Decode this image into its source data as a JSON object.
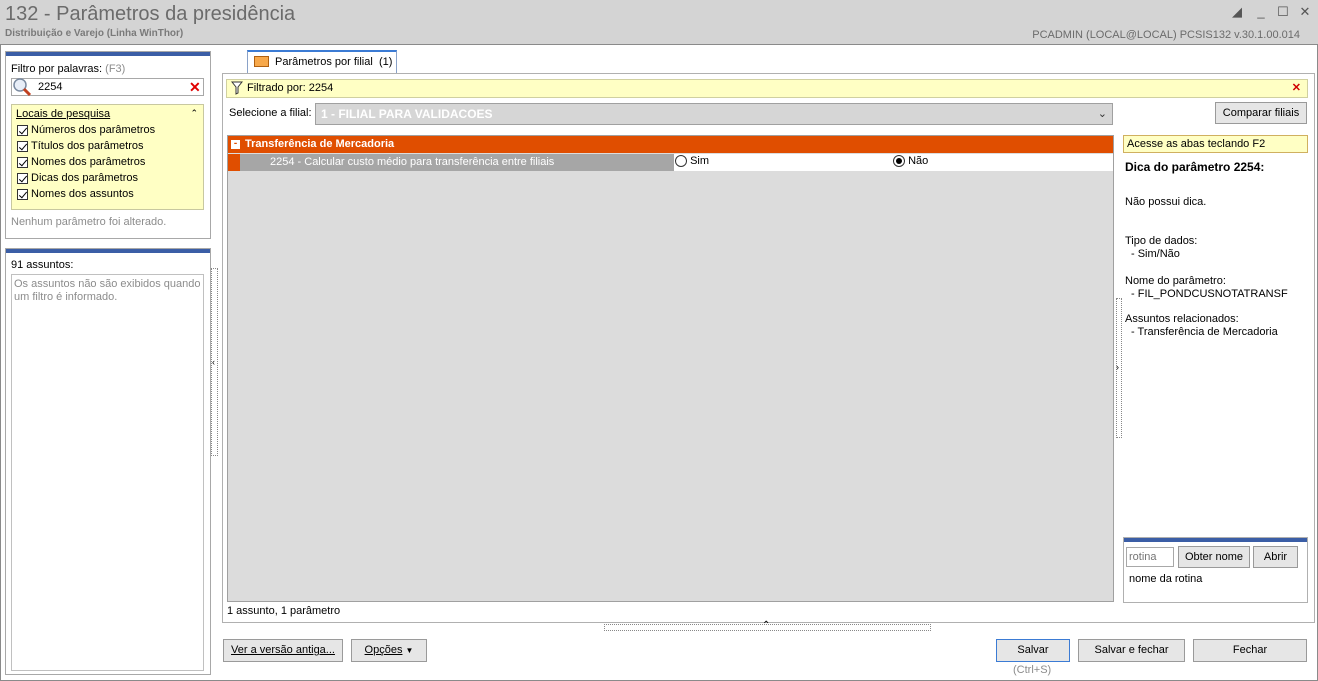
{
  "window": {
    "title": "132 - Parâmetros da presidência",
    "subtitle": "Distribuição e Varejo (Linha WinThor)",
    "user_info": "PCADMIN (LOCAL@LOCAL)   PCSIS132  v.30.1.00.014"
  },
  "sidebar": {
    "filter_label": "Filtro por palavras:",
    "filter_shortcut": "(F3)",
    "filter_value": "2254",
    "search_locations_title": "Locais de pesquisa",
    "search_locations": [
      {
        "label": "Números dos parâmetros",
        "checked": true
      },
      {
        "label": "Títulos dos parâmetros",
        "checked": true
      },
      {
        "label": "Nomes dos parâmetros",
        "checked": true
      },
      {
        "label": "Dicas dos parâmetros",
        "checked": true
      },
      {
        "label": "Nomes dos assuntos",
        "checked": true
      }
    ],
    "status": "Nenhum parâmetro foi alterado.",
    "subjects_count": "91 assuntos:",
    "subjects_note": "Os assuntos não são exibidos quando um filtro é informado."
  },
  "tab": {
    "label": "Parâmetros por filial",
    "count": "(1)"
  },
  "filter_bar": {
    "text": "Filtrado por: 2254"
  },
  "branch": {
    "label": "Selecione a filial:",
    "value": "1 - FILIAL PARA VALIDACOES",
    "compare_button": "Comparar filiais"
  },
  "grid": {
    "group": "Transferência de Mercadoria",
    "rows": [
      {
        "label": "2254 - Calcular custo médio para transferência entre filiais",
        "option_yes": "Sim",
        "option_no": "Não",
        "selected": "Não"
      }
    ],
    "summary": "1 assunto, 1 parâmetro"
  },
  "help": {
    "hint_bar": "Acesse as abas teclando F2",
    "title": "Dica do parâmetro 2254:",
    "tip": "Não possui dica.",
    "data_type_label": "Tipo de dados:",
    "data_type_value": "- Sim/Não",
    "param_name_label": "Nome do parâmetro:",
    "param_name_value": "- FIL_PONDCUSNOTATRANSF",
    "subjects_label": "Assuntos relacionados:",
    "subjects_value": "- Transferência de Mercadoria"
  },
  "routine": {
    "placeholder": "rotina",
    "get_name_button": "Obter nome",
    "open_button": "Abrir",
    "name_label": "nome da rotina"
  },
  "footer": {
    "old_version_button": "Ver a versão antiga...",
    "options_button": "Opções",
    "save_button": "Salvar",
    "save_shortcut": "(Ctrl+S)",
    "save_close_button": "Salvar e fechar",
    "close_button": "Fechar"
  },
  "colors": {
    "accent_orange": "#e04e00",
    "hint_yellow": "#ffffc4",
    "panel_blue": "#3b5ea6"
  }
}
